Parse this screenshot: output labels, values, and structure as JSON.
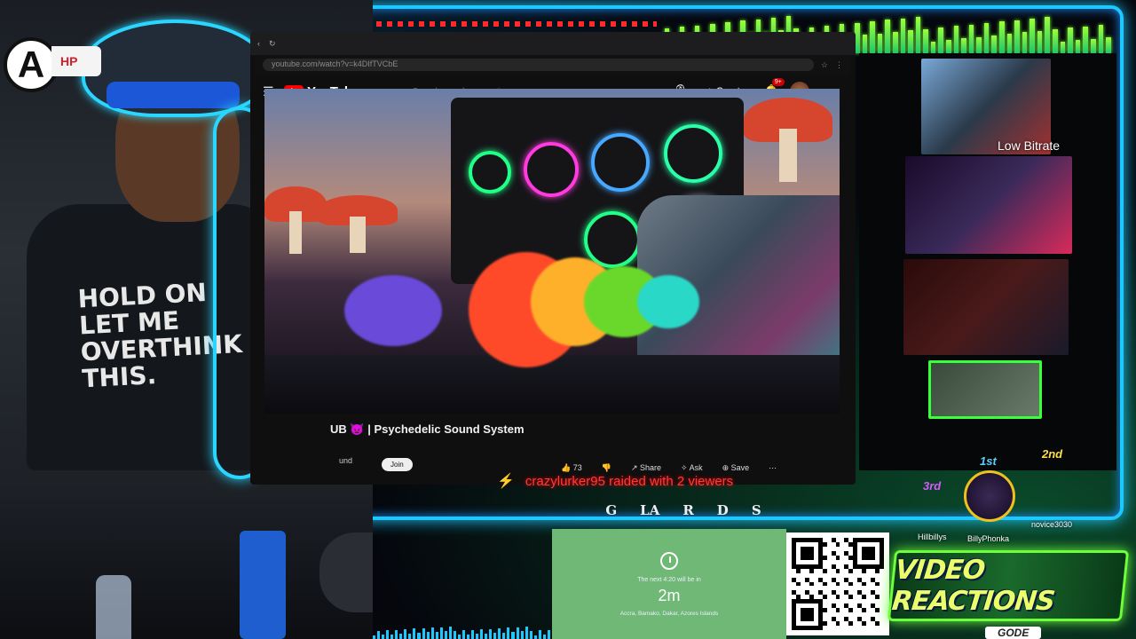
{
  "browser": {
    "url": "youtube.com/watch?v=k4DIfTVCbE",
    "search_placeholder": "Search or ask a question",
    "brand": "YouTube",
    "create_label": "Create",
    "notif_count": "9+"
  },
  "video": {
    "title": "| Psychedelic Sound System",
    "title_prefix": "UB",
    "channel_fragment": "und",
    "join_label": "Join",
    "likes": "73",
    "share_label": "Share",
    "ask_label": "Ask",
    "save_label": "Save"
  },
  "stream": {
    "webcam_shirt": "HOLD ON LET ME OVERTHINK THIS.",
    "ticker": "crazylurker95 raided with 2 viewers",
    "low_bitrate": "Low Bitrate",
    "sponsors": [
      "G",
      "LA",
      "R",
      "D",
      "S"
    ]
  },
  "timer": {
    "next_label": "The next 4:20 will be in",
    "value": "2m",
    "locations": "Accra, Bamako, Dakar, Azores Islands"
  },
  "leaderboard": {
    "first": {
      "rank": "1st",
      "name": "BillyPhonka"
    },
    "second": {
      "rank": "2nd",
      "name": "novice3030"
    },
    "third": {
      "rank": "3rd",
      "name": "Hillbillys"
    }
  },
  "banner": {
    "title": "VIDEO REACTIONS",
    "code": "GODE"
  },
  "colors": {
    "neon_blue": "#1ec8ff",
    "neon_green": "#6cff3a",
    "raid_red": "#ff3a3a",
    "yt_red": "#ff0000"
  }
}
